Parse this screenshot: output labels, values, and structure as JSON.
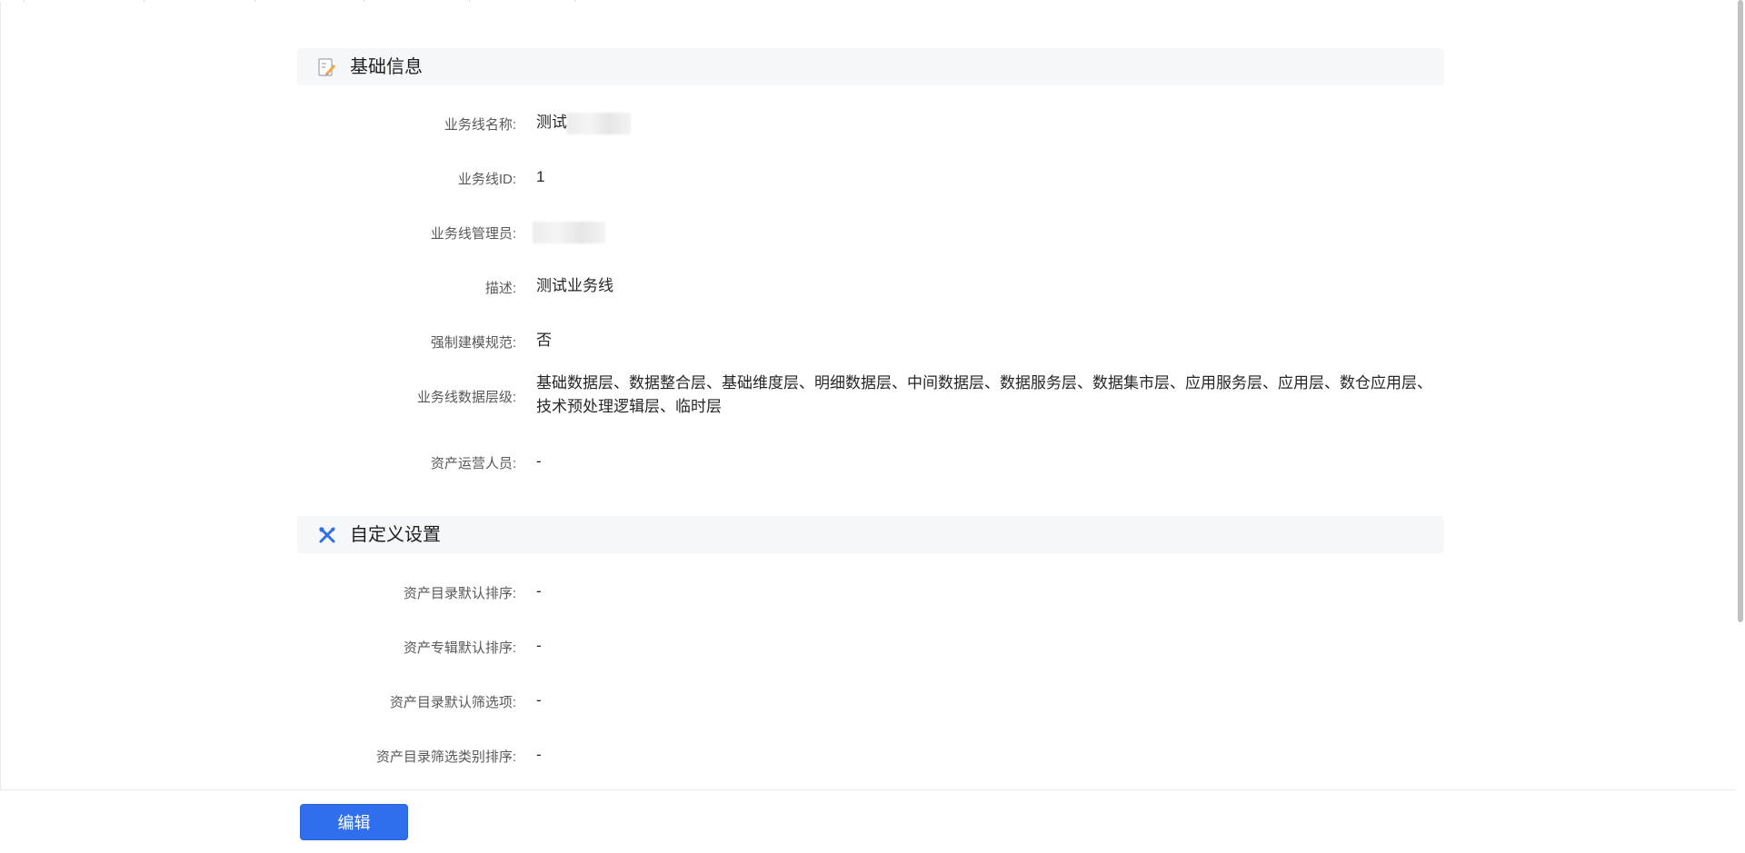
{
  "basic_info": {
    "title": "基础信息",
    "icon": "edit-document-icon",
    "fields": [
      {
        "label": "业务线名称:",
        "value": "测试"
      },
      {
        "label": "业务线ID:",
        "value": "1"
      },
      {
        "label": "业务线管理员:",
        "value": ""
      },
      {
        "label": "描述:",
        "value": "测试业务线"
      },
      {
        "label": "强制建模规范:",
        "value": "否"
      },
      {
        "label": "业务线数据层级:",
        "value": "基础数据层、数据整合层、基础维度层、明细数据层、中间数据层、数据服务层、数据集市层、应用服务层、应用层、数仓应用层、技术预处理逻辑层、临时层"
      },
      {
        "label": "资产运营人员:",
        "value": "-"
      }
    ]
  },
  "custom_settings": {
    "title": "自定义设置",
    "icon": "tools-icon",
    "fields": [
      {
        "label": "资产目录默认排序:",
        "value": "-"
      },
      {
        "label": "资产专辑默认排序:",
        "value": "-"
      },
      {
        "label": "资产目录默认筛选项:",
        "value": "-"
      },
      {
        "label": "资产目录筛选类别排序:",
        "value": "-"
      }
    ]
  },
  "actions": {
    "edit_label": "编辑"
  },
  "colors": {
    "accent": "#2f6fed",
    "section_bg": "#f6f7f9"
  }
}
